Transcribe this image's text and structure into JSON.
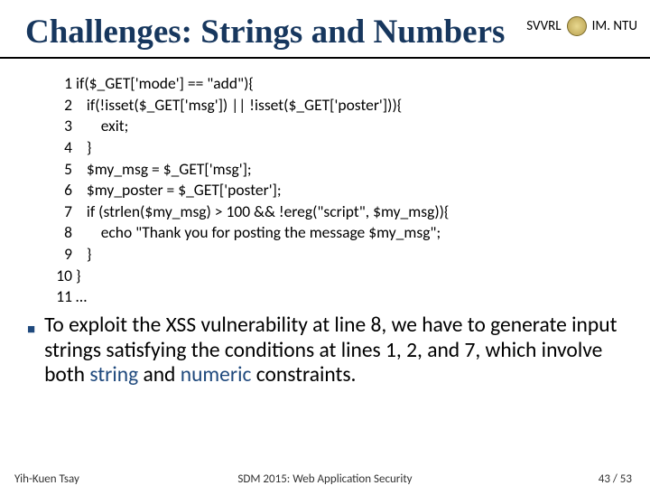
{
  "header": {
    "org_left": "SVVRL",
    "org_right": "IM. NTU"
  },
  "title": "Challenges: Strings and Numbers",
  "code": {
    "lines": [
      {
        "n": "1",
        "t": "if($_GET['mode'] == \"add\"){"
      },
      {
        "n": "2",
        "t": "   if(!isset($_GET['msg']) || !isset($_GET['poster'])){"
      },
      {
        "n": "3",
        "t": "       exit;"
      },
      {
        "n": "4",
        "t": "   }"
      },
      {
        "n": "5",
        "t": "   $my_msg = $_GET['msg'];"
      },
      {
        "n": "6",
        "t": "   $my_poster = $_GET['poster'];"
      },
      {
        "n": "7",
        "t": "   if (strlen($my_msg) > 100 && !ereg(\"script\", $my_msg)){"
      },
      {
        "n": "8",
        "t": "       echo \"Thank you for posting the message $my_msg\";"
      },
      {
        "n": "9",
        "t": "   }"
      },
      {
        "n": "10",
        "t": "}"
      },
      {
        "n": "11",
        "t": "…"
      }
    ]
  },
  "paragraph": {
    "pre": "To exploit the XSS vulnerability at line 8, we have to generate input strings satisfying the conditions at lines 1, 2, and 7, which involve both ",
    "hl1": "string",
    "mid": " and ",
    "hl2": "numeric",
    "post": " constraints."
  },
  "footer": {
    "author": "Yih-Kuen Tsay",
    "venue": "SDM 2015: Web Application Security",
    "page": "43 / 53"
  }
}
